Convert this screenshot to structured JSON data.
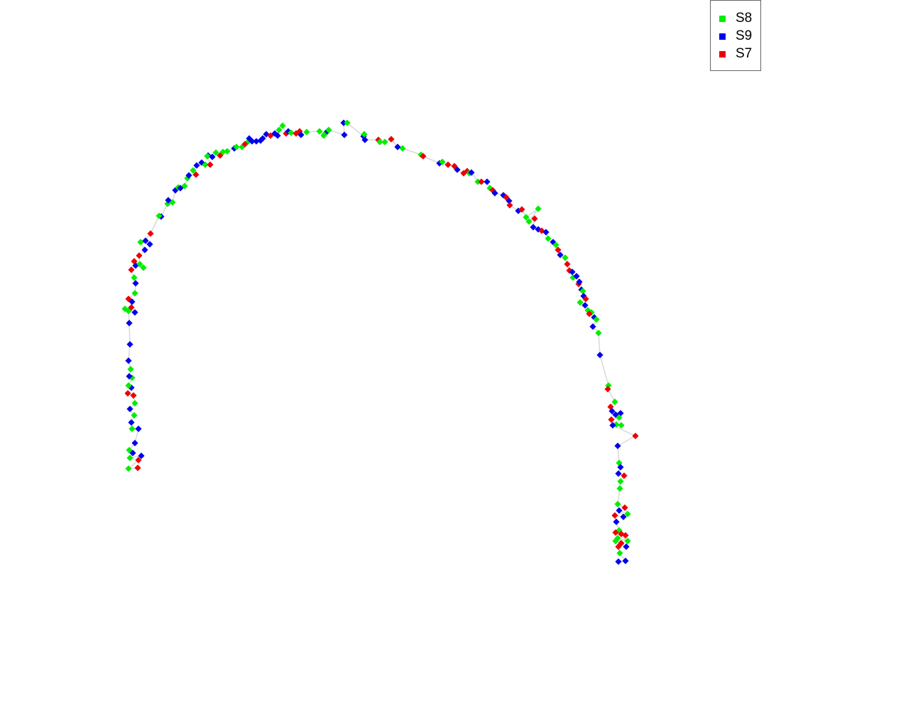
{
  "chart_data": {
    "type": "scatter",
    "title": "",
    "xlabel": "",
    "ylabel": "",
    "grid": false,
    "axes_visible": false,
    "marker": "diamond",
    "legend_position": "top-right",
    "edge_color": "#d9d9d9",
    "series": [
      {
        "name": "S8",
        "color": "#00ee00"
      },
      {
        "name": "S9",
        "color": "#0000ee"
      },
      {
        "name": "S7",
        "color": "#ee0000"
      }
    ],
    "points": [
      [
        181,
        660,
        0
      ],
      [
        183,
        645,
        0
      ],
      [
        187,
        638,
        1
      ],
      [
        194,
        659,
        2
      ],
      [
        199,
        642,
        1
      ],
      [
        195,
        648,
        2
      ],
      [
        190,
        624,
        1
      ],
      [
        182,
        634,
        0
      ],
      [
        186,
        604,
        0
      ],
      [
        195,
        604,
        1
      ],
      [
        189,
        585,
        0
      ],
      [
        185,
        595,
        1
      ],
      [
        183,
        576,
        1
      ],
      [
        190,
        568,
        0
      ],
      [
        180,
        554,
        2
      ],
      [
        185,
        546,
        1
      ],
      [
        181,
        543,
        0
      ],
      [
        188,
        557,
        2
      ],
      [
        186,
        532,
        0
      ],
      [
        182,
        530,
        1
      ],
      [
        184,
        520,
        0
      ],
      [
        181,
        508,
        1
      ],
      [
        183,
        485,
        1
      ],
      [
        181,
        438,
        0
      ],
      [
        176,
        435,
        0
      ],
      [
        182,
        455,
        1
      ],
      [
        190,
        440,
        1
      ],
      [
        185,
        433,
        2
      ],
      [
        181,
        421,
        2
      ],
      [
        186,
        425,
        1
      ],
      [
        190,
        413,
        0
      ],
      [
        191,
        399,
        1
      ],
      [
        189,
        391,
        0
      ],
      [
        185,
        380,
        2
      ],
      [
        189,
        368,
        2
      ],
      [
        191,
        374,
        1
      ],
      [
        197,
        372,
        0
      ],
      [
        202,
        377,
        0
      ],
      [
        196,
        360,
        2
      ],
      [
        204,
        352,
        1
      ],
      [
        198,
        341,
        0
      ],
      [
        211,
        344,
        1
      ],
      [
        205,
        339,
        1
      ],
      [
        212,
        329,
        2
      ],
      [
        227,
        305,
        1
      ],
      [
        224,
        304,
        0
      ],
      [
        236,
        287,
        0
      ],
      [
        243,
        285,
        0
      ],
      [
        237,
        282,
        1
      ],
      [
        247,
        268,
        1
      ],
      [
        251,
        264,
        0
      ],
      [
        254,
        265,
        1
      ],
      [
        260,
        262,
        0
      ],
      [
        264,
        251,
        0
      ],
      [
        266,
        247,
        1
      ],
      [
        276,
        246,
        2
      ],
      [
        272,
        240,
        0
      ],
      [
        277,
        233,
        1
      ],
      [
        284,
        229,
        1
      ],
      [
        289,
        232,
        0
      ],
      [
        296,
        232,
        2
      ],
      [
        293,
        219,
        1
      ],
      [
        292,
        220,
        0
      ],
      [
        299,
        221,
        1
      ],
      [
        304,
        215,
        0
      ],
      [
        310,
        219,
        2
      ],
      [
        314,
        214,
        0
      ],
      [
        320,
        213,
        0
      ],
      [
        330,
        209,
        1
      ],
      [
        333,
        207,
        0
      ],
      [
        341,
        207,
        0
      ],
      [
        345,
        203,
        2
      ],
      [
        350,
        199,
        0
      ],
      [
        351,
        195,
        1
      ],
      [
        355,
        199,
        1
      ],
      [
        361,
        199,
        1
      ],
      [
        367,
        198,
        1
      ],
      [
        370,
        195,
        1
      ],
      [
        375,
        189,
        1
      ],
      [
        381,
        191,
        2
      ],
      [
        391,
        191,
        1
      ],
      [
        387,
        188,
        1
      ],
      [
        393,
        183,
        0
      ],
      [
        398,
        177,
        0
      ],
      [
        403,
        188,
        2
      ],
      [
        406,
        185,
        1
      ],
      [
        410,
        187,
        0
      ],
      [
        417,
        188,
        2
      ],
      [
        422,
        185,
        2
      ],
      [
        424,
        190,
        1
      ],
      [
        432,
        186,
        0
      ],
      [
        450,
        185,
        0
      ],
      [
        456,
        191,
        0
      ],
      [
        458,
        188,
        0
      ],
      [
        461,
        185,
        1
      ],
      [
        463,
        183,
        0
      ],
      [
        484,
        173,
        1
      ],
      [
        489,
        173,
        0
      ],
      [
        485,
        190,
        1
      ],
      [
        512,
        192,
        1
      ],
      [
        513,
        189,
        0
      ],
      [
        514,
        197,
        1
      ],
      [
        533,
        197,
        2
      ],
      [
        535,
        200,
        0
      ],
      [
        542,
        200,
        0
      ],
      [
        551,
        196,
        2
      ],
      [
        560,
        207,
        1
      ],
      [
        567,
        209,
        0
      ],
      [
        593,
        218,
        0
      ],
      [
        596,
        220,
        2
      ],
      [
        619,
        230,
        1
      ],
      [
        623,
        228,
        0
      ],
      [
        631,
        232,
        2
      ],
      [
        640,
        234,
        2
      ],
      [
        644,
        239,
        1
      ],
      [
        653,
        244,
        2
      ],
      [
        658,
        241,
        2
      ],
      [
        661,
        244,
        0
      ],
      [
        664,
        243,
        1
      ],
      [
        673,
        256,
        0
      ],
      [
        678,
        256,
        2
      ],
      [
        686,
        256,
        1
      ],
      [
        690,
        265,
        0
      ],
      [
        694,
        268,
        2
      ],
      [
        697,
        272,
        1
      ],
      [
        709,
        275,
        1
      ],
      [
        713,
        278,
        2
      ],
      [
        717,
        283,
        1
      ],
      [
        718,
        289,
        2
      ],
      [
        730,
        297,
        1
      ],
      [
        735,
        295,
        2
      ],
      [
        741,
        306,
        0
      ],
      [
        745,
        312,
        0
      ],
      [
        753,
        308,
        2
      ],
      [
        758,
        294,
        0
      ],
      [
        751,
        320,
        1
      ],
      [
        758,
        323,
        1
      ],
      [
        763,
        325,
        2
      ],
      [
        769,
        327,
        1
      ],
      [
        772,
        336,
        0
      ],
      [
        779,
        341,
        1
      ],
      [
        783,
        345,
        0
      ],
      [
        786,
        352,
        2
      ],
      [
        789,
        359,
        1
      ],
      [
        796,
        363,
        0
      ],
      [
        799,
        372,
        2
      ],
      [
        802,
        381,
        2
      ],
      [
        806,
        383,
        1
      ],
      [
        807,
        391,
        0
      ],
      [
        812,
        389,
        1
      ],
      [
        815,
        400,
        2
      ],
      [
        819,
        408,
        1
      ],
      [
        816,
        397,
        1
      ],
      [
        821,
        410,
        0
      ],
      [
        822,
        417,
        1
      ],
      [
        825,
        421,
        2
      ],
      [
        817,
        426,
        0
      ],
      [
        824,
        430,
        1
      ],
      [
        828,
        437,
        0
      ],
      [
        833,
        440,
        0
      ],
      [
        830,
        442,
        2
      ],
      [
        837,
        447,
        1
      ],
      [
        840,
        450,
        0
      ],
      [
        835,
        460,
        1
      ],
      [
        843,
        469,
        0
      ],
      [
        845,
        500,
        1
      ],
      [
        857,
        543,
        0
      ],
      [
        856,
        548,
        2
      ],
      [
        860,
        573,
        2
      ],
      [
        866,
        566,
        0
      ],
      [
        862,
        579,
        1
      ],
      [
        867,
        584,
        1
      ],
      [
        874,
        582,
        1
      ],
      [
        872,
        588,
        0
      ],
      [
        861,
        591,
        2
      ],
      [
        868,
        598,
        0
      ],
      [
        863,
        599,
        1
      ],
      [
        875,
        599,
        0
      ],
      [
        895,
        614,
        2
      ],
      [
        870,
        628,
        1
      ],
      [
        872,
        652,
        0
      ],
      [
        874,
        658,
        1
      ],
      [
        871,
        667,
        1
      ],
      [
        879,
        670,
        2
      ],
      [
        874,
        678,
        0
      ],
      [
        873,
        688,
        0
      ],
      [
        870,
        710,
        0
      ],
      [
        872,
        719,
        1
      ],
      [
        880,
        715,
        2
      ],
      [
        884,
        724,
        0
      ],
      [
        878,
        728,
        1
      ],
      [
        866,
        726,
        2
      ],
      [
        868,
        735,
        1
      ],
      [
        872,
        747,
        0
      ],
      [
        867,
        750,
        2
      ],
      [
        875,
        752,
        2
      ],
      [
        881,
        754,
        2
      ],
      [
        870,
        758,
        0
      ],
      [
        867,
        762,
        0
      ],
      [
        875,
        765,
        2
      ],
      [
        884,
        762,
        0
      ],
      [
        871,
        770,
        2
      ],
      [
        882,
        770,
        1
      ],
      [
        873,
        779,
        0
      ],
      [
        871,
        791,
        1
      ],
      [
        881,
        790,
        1
      ]
    ]
  },
  "legend": {
    "items": [
      {
        "label": "S8",
        "color": "#00ee00"
      },
      {
        "label": "S9",
        "color": "#0000ee"
      },
      {
        "label": "S7",
        "color": "#ee0000"
      }
    ]
  }
}
